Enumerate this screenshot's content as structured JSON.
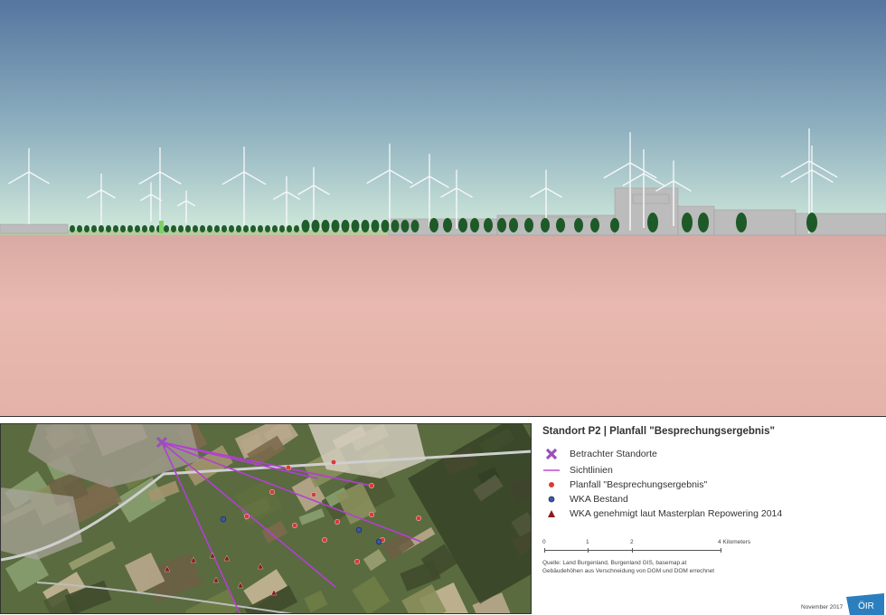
{
  "panorama": {
    "sky_top_color": "#5b7aa6",
    "sky_bottom_color": "#cde6d8",
    "ground_color": "#e7b6ad",
    "tree_color": "#1f5d2a",
    "building_color": "#bfbfbf"
  },
  "legend": {
    "title": "Standort P2 | Planfall \"Besprechungsergebnis\"",
    "items": [
      {
        "symbol": "x-cross-icon",
        "color": "#9b4fb8",
        "label": "Betrachter Standorte"
      },
      {
        "symbol": "line-icon",
        "color": "#c04fd0",
        "label": "Sichtlinien"
      },
      {
        "symbol": "red-dot-icon",
        "color": "#d83a3a",
        "label": "Planfall \"Besprechungsergebnis\""
      },
      {
        "symbol": "blue-dot-icon",
        "color": "#3a5aa8",
        "label": "WKA Bestand"
      },
      {
        "symbol": "red-triangle-icon",
        "color": "#8b1a1a",
        "label": "WKA genehmigt laut Masterplan Repowering 2014"
      }
    ],
    "scale": {
      "ticks": [
        "0",
        "1",
        "2",
        "4 Kilometers"
      ]
    },
    "source_line1": "Quelle: Land Burgenland, Burgenland GIS, basemap.at",
    "source_line2": "Gebäudehöhen aus Verschneidung von DGM und DOM errechnet",
    "date": "November 2017",
    "logo_text": "ÖIR"
  }
}
